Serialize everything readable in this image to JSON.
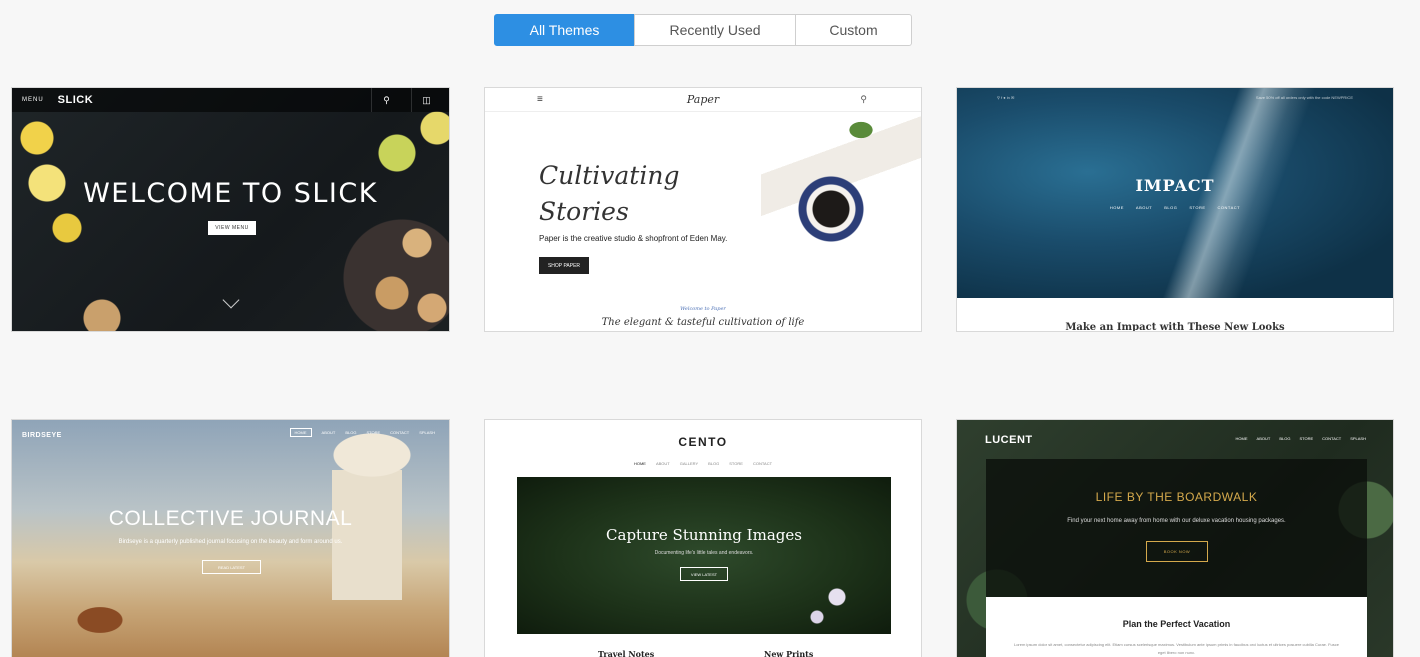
{
  "tabs": [
    {
      "label": "All Themes",
      "active": true
    },
    {
      "label": "Recently Used",
      "active": false
    },
    {
      "label": "Custom",
      "active": false
    }
  ],
  "themes": {
    "slick": {
      "menu": "MENU",
      "brand": "SLICK",
      "headline": "WELCOME TO SLICK",
      "button": "VIEW MENU"
    },
    "paper": {
      "logo": "Paper",
      "headline_line1": "Cultivating",
      "headline_line2": "Stories",
      "subtitle": "Paper is the creative studio & shopfront of Eden May.",
      "button": "SHOP PAPER",
      "welcome": "Welcome to Paper",
      "tagline": "The elegant & tasteful cultivation of life"
    },
    "impact": {
      "title": "IMPACT",
      "nav": [
        "HOME",
        "ABOUT",
        "BLOG",
        "STORE",
        "CONTACT"
      ],
      "top_right": "Save 50% off all orders only with the code NEWPRICE",
      "caption": "Make an Impact with These New Looks"
    },
    "birdseye": {
      "brand": "BIRDSEYE",
      "nav": [
        "HOME",
        "ABOUT",
        "BLOG",
        "STORE",
        "CONTACT",
        "SPLASH"
      ],
      "headline": "COLLECTIVE JOURNAL",
      "subtitle": "Birdseye is a quarterly published journal focusing on the beauty and form around us.",
      "button": "READ LATEST"
    },
    "cento": {
      "brand": "CENTO",
      "nav": [
        "HOME",
        "ABOUT",
        "GALLERY",
        "BLOG",
        "STORE",
        "CONTACT"
      ],
      "headline": "Capture Stunning Images",
      "subtitle": "Documenting life's little tales and endeavors.",
      "button": "VIEW LATEST",
      "col1": "Travel Notes",
      "col2": "New Prints"
    },
    "lucent": {
      "brand": "LUCENT",
      "nav": [
        "HOME",
        "ABOUT",
        "BLOG",
        "STORE",
        "CONTACT",
        "SPLASH"
      ],
      "headline": "LIFE BY THE BOARDWALK",
      "subtitle": "Find your next home away from home with our deluxe vacation housing packages.",
      "button": "BOOK NOW",
      "section_title": "Plan the Perfect Vacation",
      "lorem": "Lorem ipsum dolor sit amet, consectetur adipiscing elit. Etiam cursus scelerisque maximus. Vestibulum ante ipsum primis in faucibus orci luctus et ultrices posuere cubilia Curae. Fusce eget libero non nunc."
    }
  },
  "colors": {
    "accent": "#2d8fe3",
    "lucent_gold": "#d4a94c",
    "paper_blue": "#4a6fb5"
  }
}
